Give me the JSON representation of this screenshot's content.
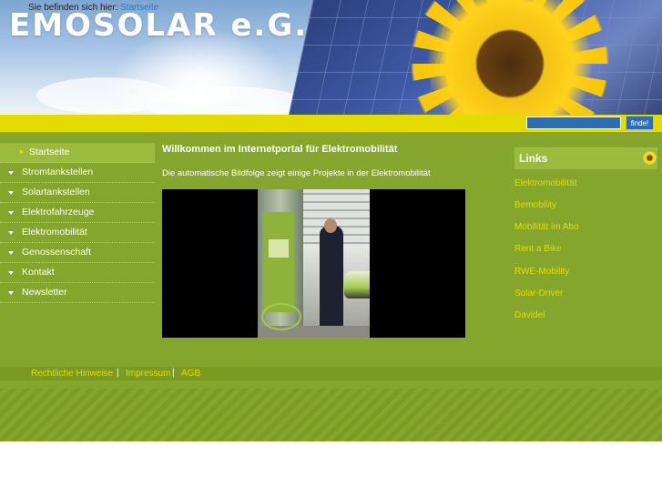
{
  "header": {
    "site_title": "EMOSOLAR e.G."
  },
  "breadcrumb": {
    "label": "Sie befinden sich hier:",
    "current": "Startseite"
  },
  "search": {
    "placeholder": "",
    "button_label": "finde!"
  },
  "sidebar": {
    "items": [
      {
        "label": "Startseite",
        "active": true
      },
      {
        "label": "Stromtankstellen"
      },
      {
        "label": "Solartankstellen"
      },
      {
        "label": "Elektrofahrzeuge"
      },
      {
        "label": "Elektromobilität"
      },
      {
        "label": "Genossenschaft"
      },
      {
        "label": "Kontakt"
      },
      {
        "label": "Newsletter"
      }
    ]
  },
  "content": {
    "title": "Willkommen im Internetportal für Elektromobilität",
    "intro": "Die automatische Bildfolge zeigt einige Projekte in der Elektromobilität"
  },
  "links_panel": {
    "title": "Links",
    "icon": "sunflower-icon",
    "items": [
      "Elektromobilität",
      "Bemobility",
      "Mobilität im Abo",
      "Rent a Bike",
      "RWE-Mobility",
      "Solar-Driver",
      "Davidel"
    ]
  },
  "footer": {
    "links": [
      "Rechtliche Hinweise",
      "Impressum",
      "AGB"
    ],
    "separator": "|"
  },
  "colors": {
    "accent_yellow": "#e4dc00",
    "main_green": "#85a62c",
    "link_blue": "#2a7bbf",
    "search_blue": "#2d6db5"
  }
}
